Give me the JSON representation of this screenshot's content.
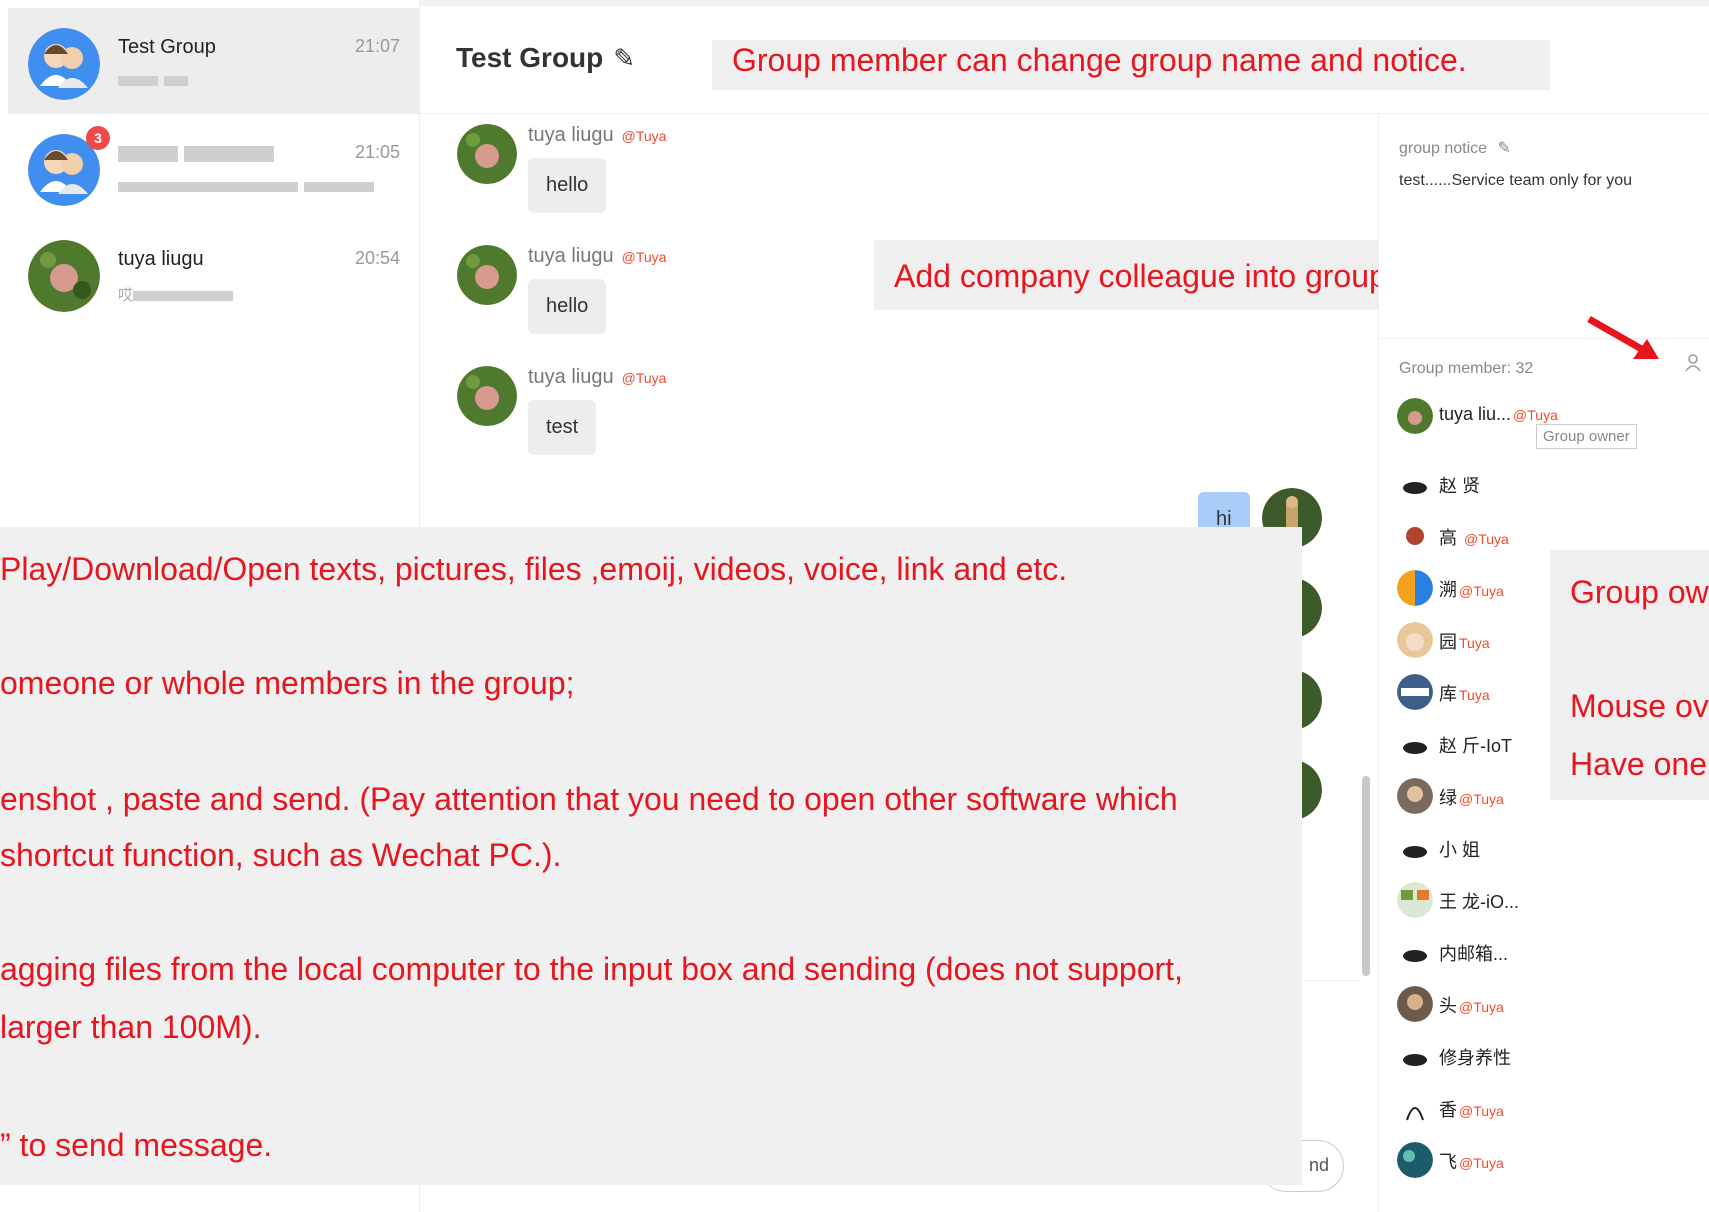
{
  "sidebar": {
    "conversations": [
      {
        "name": "Test Group",
        "time": "21:07",
        "preview": "",
        "badge": ""
      },
      {
        "name": "",
        "time": "21:05",
        "preview": "",
        "badge": "3"
      },
      {
        "name": "tuya liugu",
        "time": "20:54",
        "preview": "哎",
        "badge": ""
      }
    ]
  },
  "header": {
    "title": "Test Group",
    "edit_icon": "✎"
  },
  "annotations": {
    "top": "Group member can change group name and notice.",
    "middle": "Add company colleague into group chat",
    "left_lines": [
      "Play/Download/Open texts, pictures, files ,emoij, videos, voice, link and etc.",
      "omeone or whole members in the group;",
      "enshot , paste and send. (Pay attention that you need to open other software which",
      "shortcut function, such as Wechat PC.).",
      "agging files from the local computer to the input box and sending (does not support,",
      "larger than 100M).",
      "” to send message."
    ],
    "right_lines": [
      "Group ow",
      "Mouse ov",
      "Have one"
    ]
  },
  "chat": {
    "messages": [
      {
        "sender": "tuya liugu",
        "org": "@Tuya",
        "text": "hello"
      },
      {
        "sender": "tuya liugu",
        "org": "@Tuya",
        "text": "hello"
      },
      {
        "sender": "tuya liugu",
        "org": "@Tuya",
        "text": "test"
      },
      {
        "sender": "",
        "org": "",
        "text": "hi",
        "self": true
      }
    ],
    "send_label": "nd"
  },
  "panel": {
    "notice_title": "group notice",
    "notice_text": "test......Service team only for you",
    "member_count_label": "Group member: 32",
    "owner_tag": "Group owner",
    "members": [
      {
        "name": "tuya liu...",
        "org": "@Tuya"
      },
      {
        "name": "赵  贤",
        "org": ""
      },
      {
        "name": "高 ",
        "org": "@Tuya"
      },
      {
        "name": "溯",
        "org": "@Tuya"
      },
      {
        "name": "园",
        "org": "Tuya"
      },
      {
        "name": "库",
        "org": "Tuya"
      },
      {
        "name": "赵  斤-IoT",
        "org": ""
      },
      {
        "name": "绿",
        "org": "@Tuya"
      },
      {
        "name": "小  姐",
        "org": ""
      },
      {
        "name": "王  龙-iO...",
        "org": ""
      },
      {
        "name": "  内邮箱...",
        "org": ""
      },
      {
        "name": "  头",
        "org": "@Tuya"
      },
      {
        "name": "  修身养性",
        "org": ""
      },
      {
        "name": "  香",
        "org": "@Tuya"
      },
      {
        "name": "  飞",
        "org": "@Tuya"
      }
    ]
  },
  "colors": {
    "annotation_text": "#e8151e",
    "org_tag": "#f04b2f",
    "badge": "#f04848",
    "self_bubble": "#a7ccf7"
  }
}
